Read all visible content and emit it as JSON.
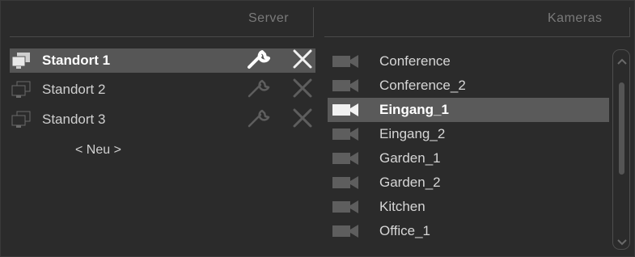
{
  "headers": {
    "server": "Server",
    "cameras": "Kameras"
  },
  "servers": [
    {
      "label": "Standort 1",
      "selected": true
    },
    {
      "label": "Standort 2",
      "selected": false
    },
    {
      "label": "Standort 3",
      "selected": false
    }
  ],
  "new_server_label": "< Neu >",
  "cameras": [
    {
      "label": "Conference",
      "selected": false
    },
    {
      "label": "Conference_2",
      "selected": false
    },
    {
      "label": "Eingang_1",
      "selected": true
    },
    {
      "label": "Eingang_2",
      "selected": false
    },
    {
      "label": "Garden_1",
      "selected": false
    },
    {
      "label": "Garden_2",
      "selected": false
    },
    {
      "label": "Kitchen",
      "selected": false
    },
    {
      "label": "Office_1",
      "selected": false
    }
  ],
  "colors": {
    "background": "#2b2b2b",
    "selection": "#565656",
    "text": "#d6d6d6",
    "header_text": "#7a7a7a"
  }
}
